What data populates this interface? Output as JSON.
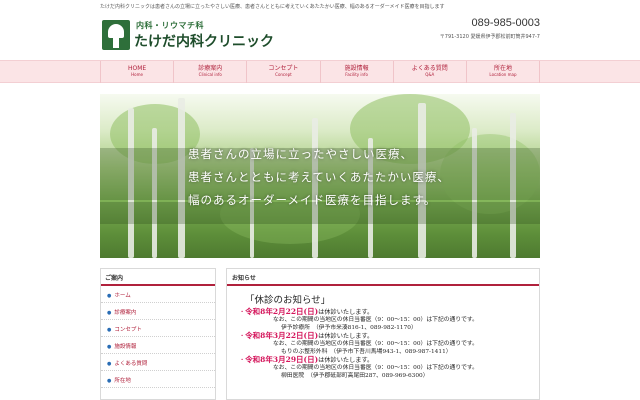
{
  "header": {
    "tagline": "たけだ内科クリニックは患者さんの立場に立ったやさしい医療、患者さんとともに考えていくあたたかい医療、幅のあるオーダーメイド医療を目指します",
    "logo_sub": "内科・リウマチ科",
    "logo_name": "たけだ内科クリニック",
    "phone": "089-985-0003",
    "address": "〒791-3120 愛媛県伊予郡松前町筒井947-7"
  },
  "nav": [
    {
      "jp": "HOME",
      "en": "Home"
    },
    {
      "jp": "診療案内",
      "en": "Clinical info"
    },
    {
      "jp": "コンセプト",
      "en": "Concept"
    },
    {
      "jp": "施設情報",
      "en": "Facility info"
    },
    {
      "jp": "よくある質問",
      "en": "Q&A"
    },
    {
      "jp": "所在地",
      "en": "Location map"
    }
  ],
  "hero": {
    "lines": [
      "患者さんの立場に立ったやさしい医療、",
      "患者さんとともに考えていくあたたかい医療、",
      "幅のあるオーダーメイド医療を目指します。"
    ]
  },
  "sidebar": {
    "title": "ご案内",
    "items": [
      "ホーム",
      "診療案内",
      "コンセプト",
      "施設情報",
      "よくある質問",
      "所在地"
    ]
  },
  "news": {
    "title": "お知らせ",
    "heading": "「休診のお知らせ」",
    "entries": [
      {
        "date": "令和8年2月22日(日)",
        "suffix": "は休診いたします。",
        "note": "なお、この期間の当地区の休日当番医（9：00～15：00）は下記の通りです。",
        "detail": "伊予診療所　（伊予市米湊816-1、089-982-1170）"
      },
      {
        "date": "令和8年3月22日(日)",
        "suffix": "は休診いたします。",
        "note": "なお、この期間の当地区の休日当番医（9：00～15：00）は下記の通りです。",
        "detail": "もりのぶ整形外科　（伊予市下吾川馬場943-1、089-987-1411）"
      },
      {
        "date": "令和8年3月29日(日)",
        "suffix": "は休診いたします。",
        "note": "なお、この期間の当地区の休日当番医（9：00～15：00）は下記の通りです。",
        "detail": "柳田医院　（伊予郡砥部町高尾田287、089-969-6300）"
      }
    ]
  }
}
